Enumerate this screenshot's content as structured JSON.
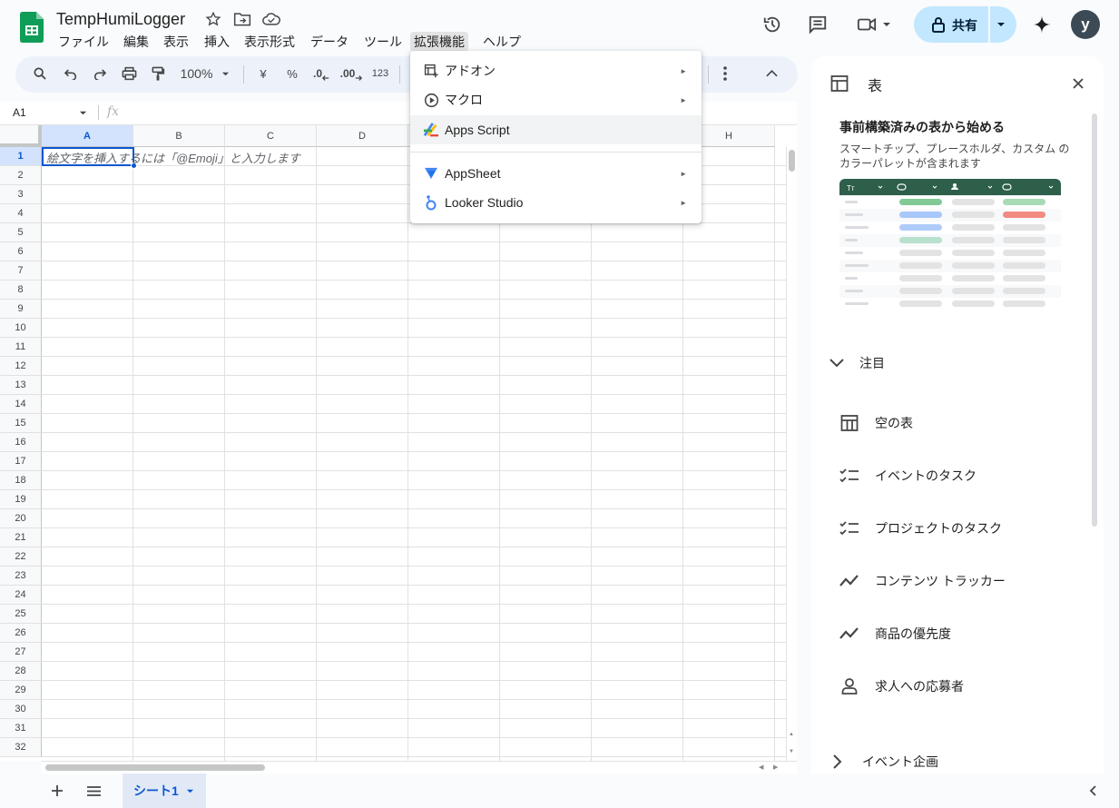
{
  "app": {
    "title": "TempHumiLogger",
    "avatar_letter": "y",
    "share_label": "共有"
  },
  "menu": [
    "ファイル",
    "編集",
    "表示",
    "挿入",
    "表示形式",
    "データ",
    "ツール",
    "拡張機能",
    "ヘルプ"
  ],
  "toolbar": {
    "zoom": "100%",
    "currency": "¥",
    "percent": "%",
    "dec_less": ".0",
    "dec_more": ".00",
    "format_123": "123"
  },
  "formula_bar": {
    "cell_ref": "A1",
    "fx": "fx"
  },
  "grid": {
    "columns": [
      "A",
      "B",
      "C",
      "D",
      "E",
      "F",
      "G",
      "H"
    ],
    "rows": [
      "1",
      "2",
      "3",
      "4",
      "5",
      "6",
      "7",
      "8",
      "9",
      "10",
      "11",
      "12",
      "13",
      "14",
      "15",
      "16",
      "17",
      "18",
      "19",
      "20",
      "21",
      "22",
      "23",
      "24",
      "25",
      "26",
      "27",
      "28",
      "29",
      "30",
      "31",
      "32"
    ],
    "a1_placeholder": "絵文字を挿入するには「@Emoji」と入力します"
  },
  "extensions_menu": {
    "items": [
      {
        "label": "アドオン",
        "icon": "addon-icon",
        "submenu": true
      },
      {
        "label": "マクロ",
        "icon": "macro-icon",
        "submenu": true
      },
      {
        "label": "Apps Script",
        "icon": "apps-script-icon",
        "submenu": false
      },
      {
        "label": "AppSheet",
        "icon": "appsheet-icon",
        "submenu": true
      },
      {
        "label": "Looker Studio",
        "icon": "looker-studio-icon",
        "submenu": true
      }
    ],
    "submenu_arrow": "►"
  },
  "side_panel": {
    "title": "表",
    "heading": "事前構築済みの表から始める",
    "description": "スマートチップ、プレースホルダ、カスタム のカラーパレットが含まれます",
    "section_featured": "注目",
    "templates": [
      {
        "label": "空の表",
        "icon": "table-icon"
      },
      {
        "label": "イベントのタスク",
        "icon": "checklist-icon"
      },
      {
        "label": "プロジェクトのタスク",
        "icon": "checklist-icon"
      },
      {
        "label": "コンテンツ トラッカー",
        "icon": "trend-icon"
      },
      {
        "label": "商品の優先度",
        "icon": "trend-icon"
      },
      {
        "label": "求人への応募者",
        "icon": "person-icon"
      }
    ],
    "section_events": "イベント企画"
  },
  "sheets": {
    "active": "シート1"
  },
  "colors": {
    "accent": "#0b57d0",
    "share_bg": "#c2e7ff",
    "sheets_green": "#0f9d58",
    "preview_header": "#2d5f4a"
  }
}
